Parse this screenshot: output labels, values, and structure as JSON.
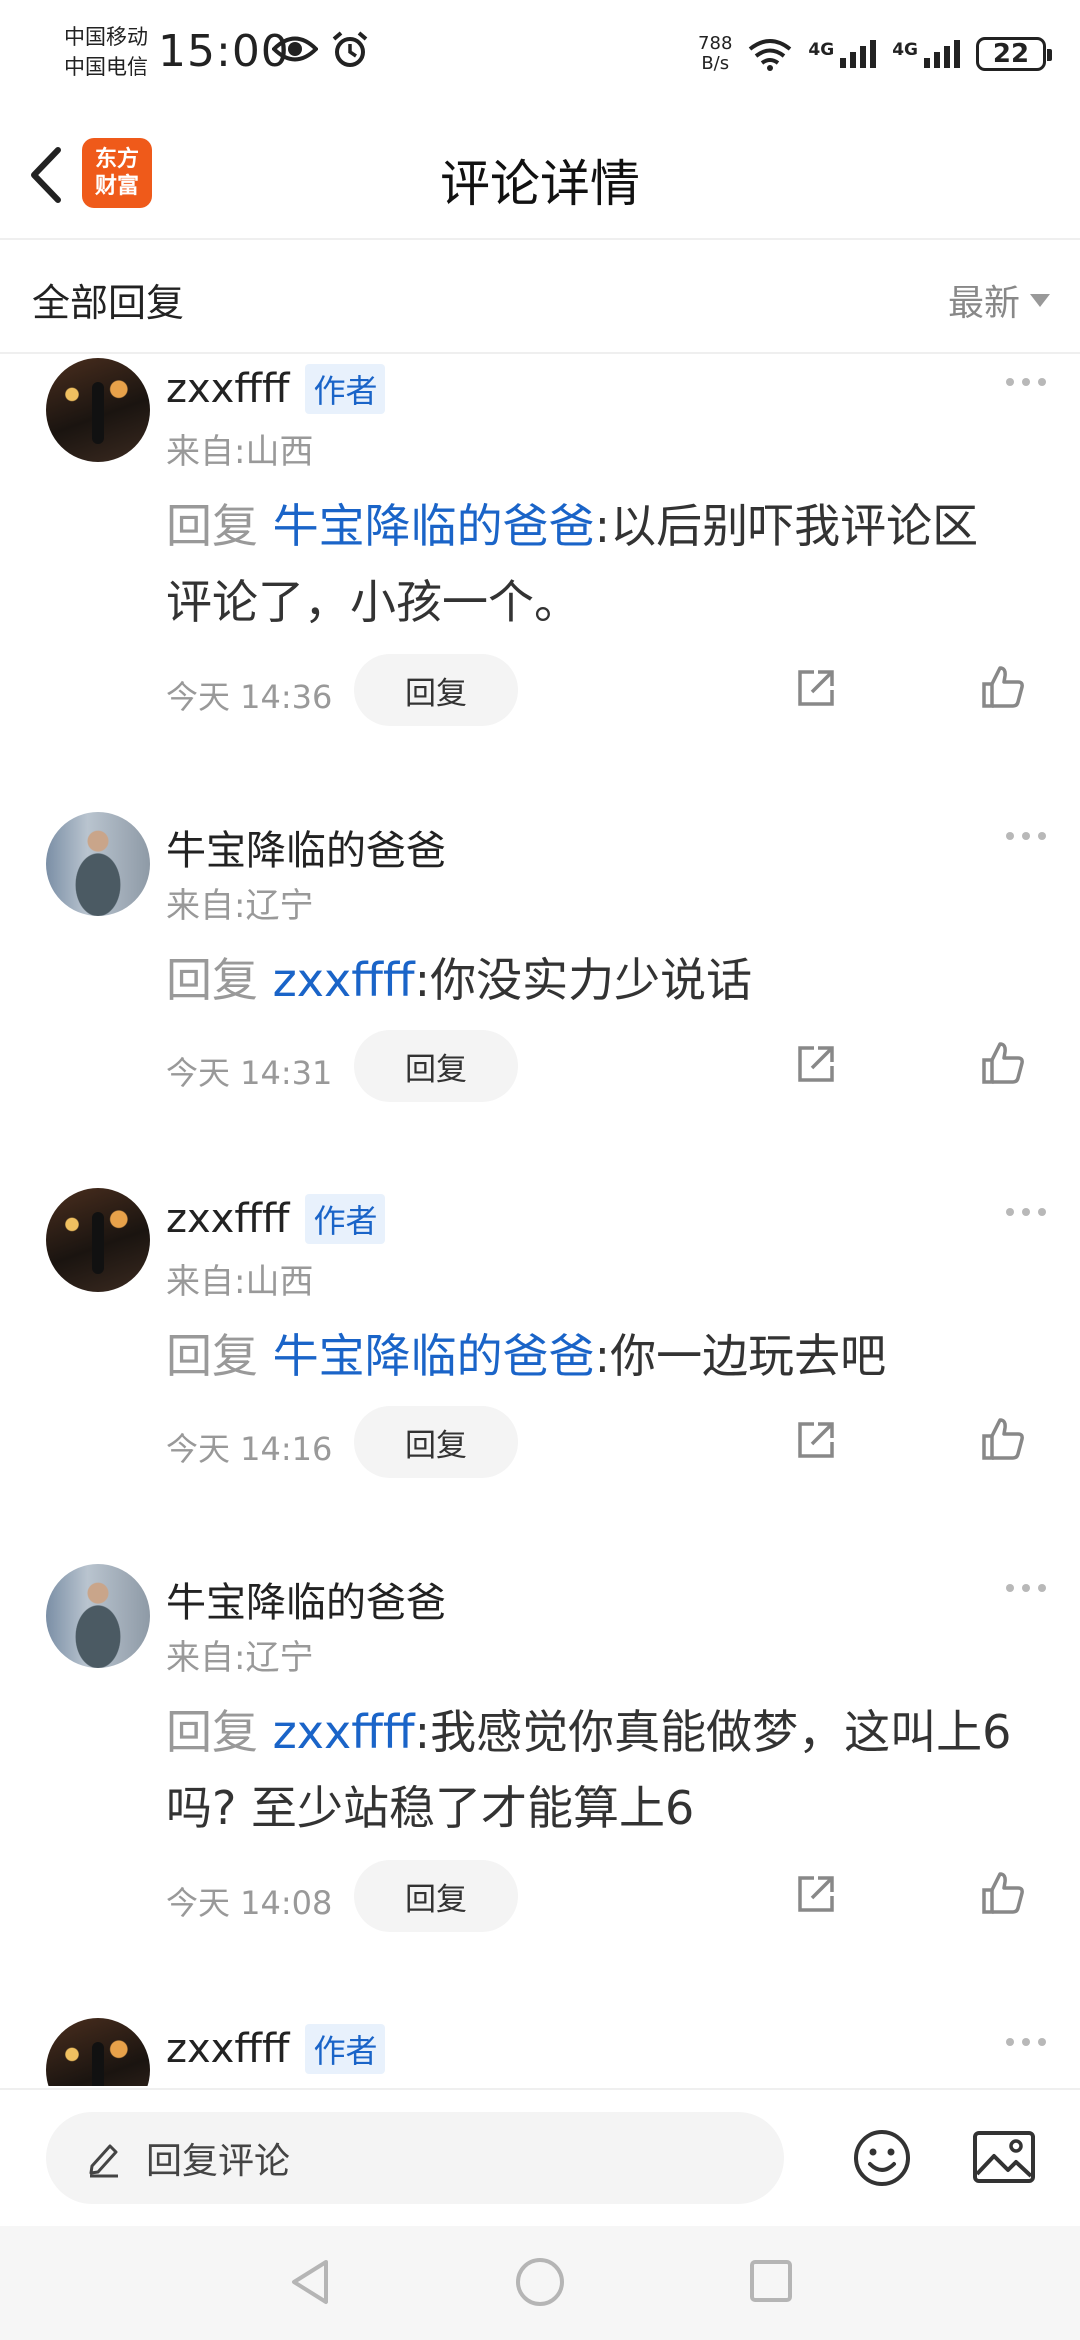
{
  "status_bar": {
    "carrier_1": "中国移动",
    "carrier_2": "中国电信",
    "time": "15:00",
    "net_speed_value": "788",
    "net_speed_unit": "B/s",
    "signal_1_label": "4G",
    "signal_2_label": "4G",
    "battery": "22"
  },
  "header": {
    "title": "评论详情",
    "logo_line_1": "东方",
    "logo_line_2": "财富"
  },
  "filter": {
    "title": "全部回复",
    "sort_label": "最新"
  },
  "comments": [
    {
      "author": "zxxffff",
      "badge": "作者",
      "location": "来自:山西",
      "reply_label": "回复",
      "mention": "牛宝降临的爸爸",
      "text": ":以后别吓我评论区评论了，小孩一个。",
      "time": "今天 14:36",
      "reply_button": "回复"
    },
    {
      "author": "牛宝降临的爸爸",
      "badge": "",
      "location": "来自:辽宁",
      "reply_label": "回复",
      "mention": "zxxffff",
      "text": ":你没实力少说话",
      "time": "今天 14:31",
      "reply_button": "回复"
    },
    {
      "author": "zxxffff",
      "badge": "作者",
      "location": "来自:山西",
      "reply_label": "回复",
      "mention": "牛宝降临的爸爸",
      "text": ":你一边玩去吧",
      "time": "今天 14:16",
      "reply_button": "回复"
    },
    {
      "author": "牛宝降临的爸爸",
      "badge": "",
      "location": "来自:辽宁",
      "reply_label": "回复",
      "mention": "zxxffff",
      "text": ":我感觉你真能做梦，这叫上6吗? 至少站稳了才能算上6",
      "time": "今天 14:08",
      "reply_button": "回复"
    },
    {
      "author": "zxxffff",
      "badge": "作者",
      "location": "",
      "reply_label": "",
      "mention": "",
      "text": "",
      "time": "",
      "reply_button": ""
    }
  ],
  "bottom_bar": {
    "reply_placeholder": "回复评论"
  },
  "colors": {
    "accent_blue": "#1a64c8",
    "logo_orange": "#ef5a1a",
    "muted_gray": "#999999"
  },
  "icons": [
    "back-arrow-icon",
    "eye-icon",
    "alarm-icon",
    "wifi-icon",
    "signal-icon",
    "more-icon",
    "share-icon",
    "like-icon",
    "pencil-icon",
    "emoji-icon",
    "image-icon",
    "nav-back-icon",
    "nav-home-icon",
    "nav-recent-icon"
  ]
}
